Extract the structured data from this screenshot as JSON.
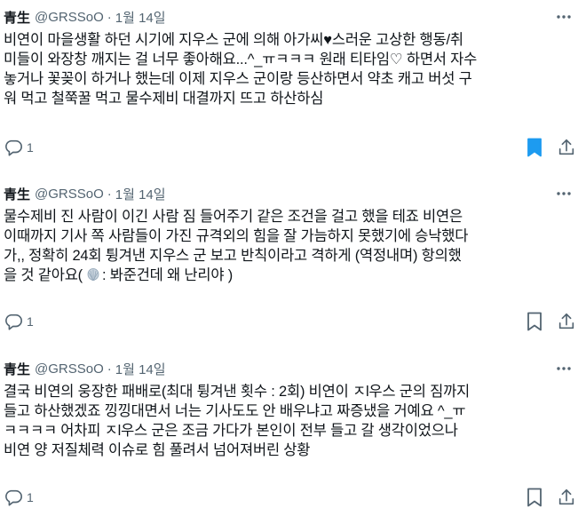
{
  "posts": [
    {
      "author": "青生",
      "handle": "@GRSSoO",
      "separator": "·",
      "date": "1월 14일",
      "lines": [
        "비연이 마을생활 하던 시기에 지우스 군에 의해 아가씨♥스러운 고상한 행동/취",
        "미들이 와장창 깨지는 걸 너무 좋아해요...^_ㅠㅋㅋㅋ 원래 티타임♡ 하면서 자수",
        "놓거나 꽃꽂이 하거나 했는데 이제 지우스 군이랑 등산하면서 약초 캐고 버섯 구",
        "워 먹고 철쭉꿀 먹고 물수제비 대결까지 뜨고 하산하심"
      ],
      "reply_count": "1",
      "bookmarked": true
    },
    {
      "author": "青生",
      "handle": "@GRSSoO",
      "separator": "·",
      "date": "1월 14일",
      "lines": [
        "물수제비 진 사람이 이긴 사람 짐 들어주기 같은 조건을 걸고 했을 테죠 비연은",
        "이때까지 기사 쪽 사람들이 가진 규격외의 힘을 잘 가늠하지 못했기에 승낙했다",
        "가,, 정확히 24회 튕겨낸 지우스 군 보고 반칙이라고 격하게 (역정내며) 항의했",
        "을 것 같아요("
      ],
      "last_line_after_emoji": ": 봐준건데 왜 난리야 )",
      "reply_count": "1",
      "bookmarked": false
    },
    {
      "author": "青生",
      "handle": "@GRSSoO",
      "separator": "·",
      "date": "1월 14일",
      "lines": [
        "결국 비연의 웅장한 패배로(최대 튕겨낸 횟수 : 2회) 비연이 ㅈl우스 군의 짐까지",
        "들고 하산했겠죠 낑낑대면서 너는 기사도도 안 배우냐고 짜증냈을 거예요 ^_ㅠ",
        "ㅋㅋㅋㅋ 어차피 ㅈl우스 군은 조금 가다가 본인이 전부 들고 갈 생각이었으나",
        "비연 양 저질체력 이슈로 힘 풀려서 넘어져버린 상황"
      ],
      "reply_count": "1",
      "bookmarked": false
    }
  ],
  "icons": {
    "reply": "speech-bubble-icon",
    "bookmark": "bookmark-icon",
    "share": "share-icon",
    "more": "more-icon",
    "shell": "shell-emoji-icon"
  },
  "colors": {
    "text": "#0f1419",
    "secondary": "#536471",
    "accent": "#1d9bf0"
  }
}
